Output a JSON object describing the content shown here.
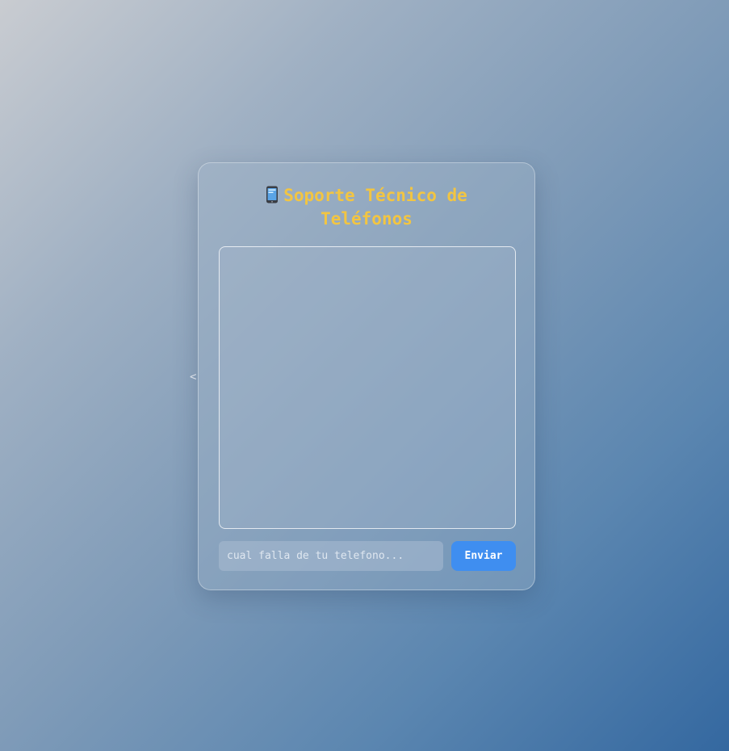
{
  "stray_text": "<",
  "card": {
    "title": "Soporte Técnico de Teléfonos",
    "icon": "mobile-phone-icon",
    "colors": {
      "title": "#f2c542",
      "button": "#3f8ef0"
    }
  },
  "chat": {
    "messages": []
  },
  "input": {
    "placeholder": "cual falla de tu telefono...",
    "value": ""
  },
  "send_button": {
    "label": "Enviar"
  }
}
